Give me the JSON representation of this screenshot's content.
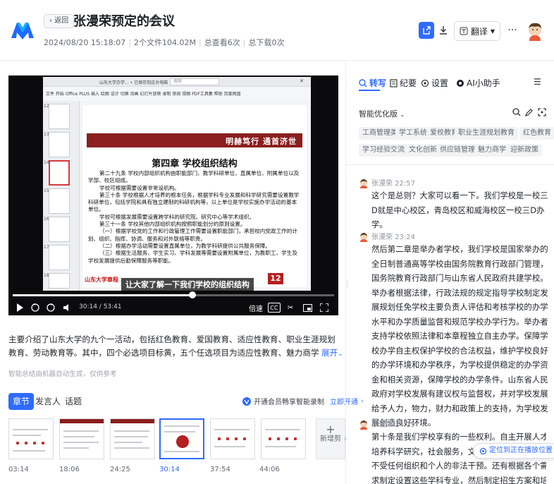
{
  "header": {
    "back_label": "返回",
    "title": "张漫荣预定的会议",
    "date": "2024/08/20 15:18:07",
    "files": "2个文件104.02M",
    "views": "总查看6次",
    "downloads": "总下载0次",
    "translate_label": "翻译",
    "brand_color": "#2f6bff"
  },
  "video": {
    "window_title": "山东大学办学... • 已保存到这台电脑",
    "search_placeholder": "搜索",
    "menu_items": "文件 开始 Office PLUS 插入 绘图 设计 切换 动画 幻灯片放映 录制 审阅 视图 PDF工具集 帮助 百度网盘",
    "slide_banner": "明赫笃行 通首济世",
    "slide_heading": "第四章 学校组织结构",
    "slide_paragraphs": [
      "第二十九条 学校内部组织机构由职能部门、教学科研单位、直属单位、附属单位以及学部、校区组成。",
      "学校可根据需要设置非常设机构。",
      "第三十条 学校根据人才培养的根本任务，根据学科专业发展和科学研究需要设置教学科研单位，包括学院和具有独立建制的科研机构等，以上单位是学校实施办学活动的基本单位。",
      "学校可根据发展需要设置跨学科的研究院、研究中心等学术组织。",
      "第三十一条 学校其他内部组织机构按照职能划分的原则设置。",
      "（一）根据学校党的工作和行政管理工作需要设置职能部门，承担校内党政工作的计划、组织、指挥、协调、服务和对外联络等职责。",
      "（二）根据办学活动需要设置直属单位，为教学科研提供公共服务保障。",
      "（三）根据生活服务、学生实习、学科发展等需要设置附属单位，为教职工、学生及学校发展提供后勤保障服务等职能。"
    ],
    "slide_footer": "山东大学章程",
    "slide_number": "12",
    "subtitle": "让大家了解一下我们学校的组织结构",
    "time_display": "30:14 / 53:41",
    "speed_label": "倍速",
    "cc_label": "CC",
    "progress": 0.56,
    "thumb_numbers": [
      "12",
      "13",
      "14",
      "15",
      "16",
      "17",
      "18"
    ]
  },
  "summary": {
    "text": "主要介绍了山东大学的九个一活动，包括红色教育、爱国教育、适应性教育、职业生涯规划教育、劳动教育等。其中，四个必选项目标黄，五个任选项目为适应性教育、魅力商学、职业生涯规划教育和实践教育。此外，还介绍",
    "expand_label": "展开",
    "note": "智能总结由机器自动生成，仅供参考"
  },
  "tabs": [
    "章节",
    "发言人",
    "话题"
  ],
  "vip": {
    "text": "开通会员畅享智能录制",
    "link": "立即开通"
  },
  "chapters": {
    "times": [
      "03:14",
      "18:06",
      "24:25",
      "30:14",
      "37:54",
      "44:06"
    ],
    "new_clip_label": "新增剪",
    "new_clip_plus": "+"
  },
  "right": {
    "tabs": [
      "转写",
      "纪要",
      "设置",
      "AI小助手"
    ],
    "mode": "智能优化版",
    "keywords": [
      "工商管理类",
      "学工系统",
      "爱校教育",
      "职业生涯规划教育",
      "红色教育",
      "学习经验交流会",
      "文化创新",
      "供应链管理",
      "魅力商学",
      "迎新政策"
    ],
    "locate_label": "定位到正在播放位置",
    "entries": [
      {
        "speaker": "张漫荣",
        "time": "22:57",
        "text": "这个是总则？大家可以看一下。我们学校是一校三D就是中心校区，青岛校区和威海校区一校三D办学。"
      },
      {
        "speaker": "张漫荣",
        "time": "23:24",
        "text": "然后第二章是举办者学校，我们学校是国家举办的全日制普通高等学校由国务院教育行政部门管理，国务院教育行政部门与山东省人民政府共建学校。举办者根据法律，行政法规的规定指导学校制定发展规划任免学校主要负责人评估和考核学校的办学水平和办学质量监督和规范学校办学行为。举办者支持学校依照法律和本章程独立自主办学。保障学校办学自主权保护学校的合法权益，维护学校良好的办学环境和办学秩序，为学校提供稳定的办学资金和相关资源，保障学校的办学条件。山东省人民政府对学校发展有建议权与监督权，并对学校发展给予人力，物力，财力和政策上的支持，为学校发展创造良好环境。"
      },
      {
        "speaker": "张漫荣",
        "time": "24:25",
        "text": "第十条是我们学校享有的一些权利。自主开展人才培养科学研究，社会服务，文化创新的活动，学校不受任何组织和个人的非法干预。还有根据各个需求制定设置这些学科专业，然后制定招生方案和培养方案，制定教学计划，选编教材，组"
      }
    ]
  }
}
